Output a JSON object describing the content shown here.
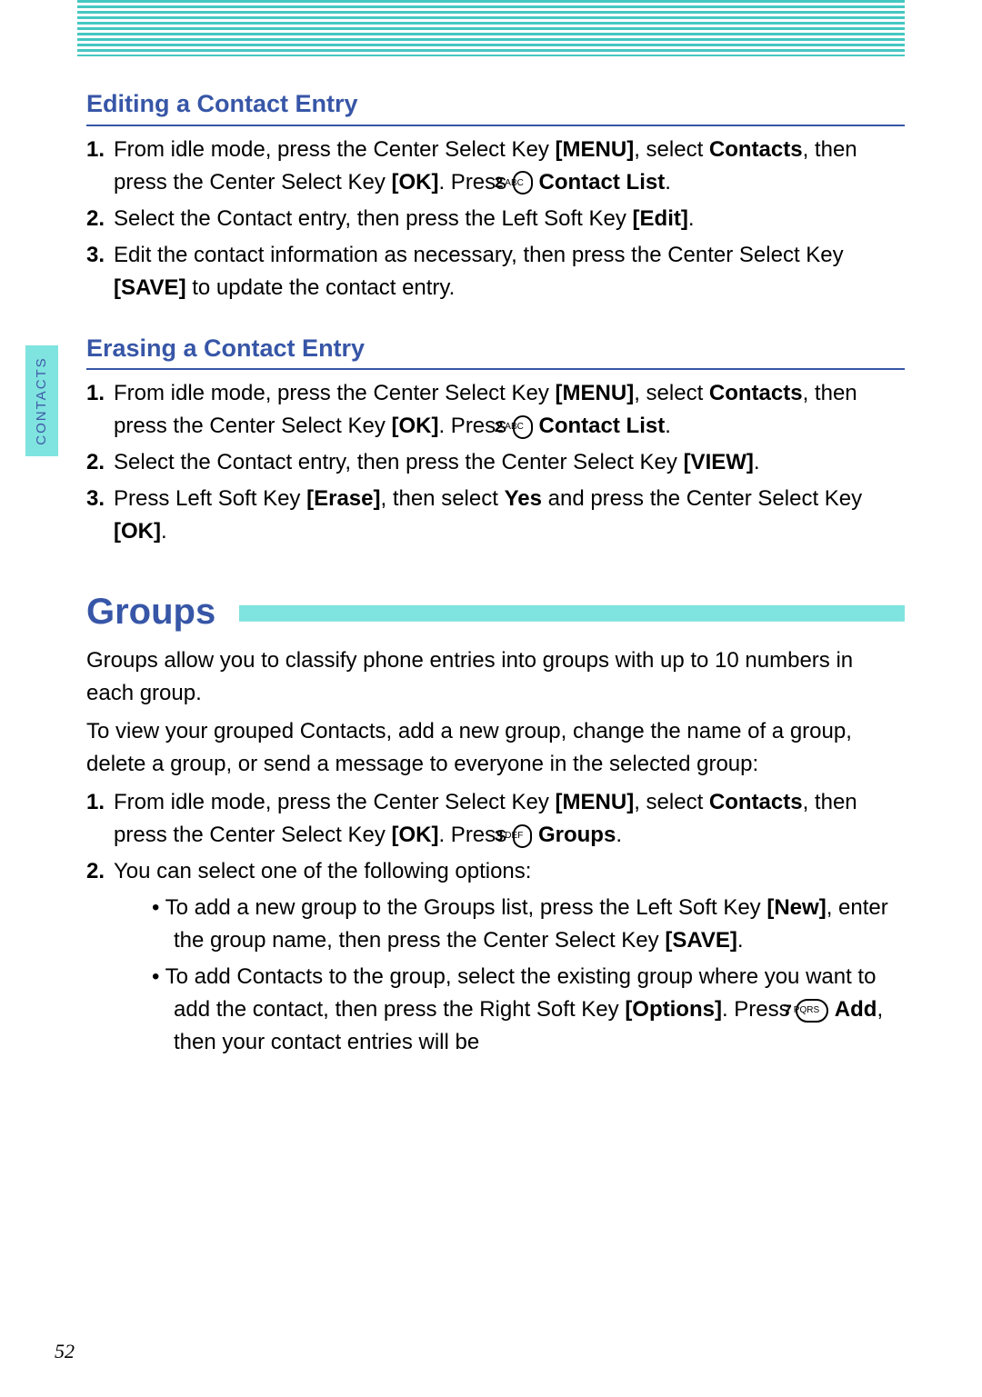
{
  "sidebarTab": "CONTACTS",
  "pageNumber": "52",
  "keys": {
    "menu": "[MENU]",
    "ok": "[OK]",
    "edit": "[Edit]",
    "save": "[SAVE]",
    "view": "[VIEW]",
    "erase": "[Erase]",
    "new": "[New]",
    "options": "[Options]"
  },
  "phoneKeys": {
    "k2": {
      "num": "2",
      "letters": "ABC"
    },
    "k3": {
      "num": "3",
      "letters": "DEF"
    },
    "k7": {
      "num": "7",
      "letters": "PQRS"
    }
  },
  "editing": {
    "heading": "Editing a Contact Entry",
    "s1a": "From idle mode, press the Center Select Key ",
    "s1b": ", select ",
    "s1c": "Contacts",
    "s1d": ", then press the Center Select Key ",
    "s1e": ". Press ",
    "s1f": "Contact List",
    "s1g": ".",
    "s2a": "Select the Contact entry, then press the Left Soft Key ",
    "s2b": ".",
    "s3a": "Edit the contact information as necessary, then press the Center Select Key ",
    "s3b": " to update the contact entry."
  },
  "erasing": {
    "heading": "Erasing a Contact Entry",
    "s1a": "From idle mode, press the Center Select Key ",
    "s1b": ", select ",
    "s1c": "Contacts",
    "s1d": ", then press the Center Select Key ",
    "s1e": ". Press ",
    "s1f": "Contact List",
    "s1g": ".",
    "s2a": "Select the Contact entry, then press the Center Select Key ",
    "s2b": ".",
    "s3a": "Press Left Soft Key ",
    "s3b": ", then select ",
    "s3c": "Yes",
    "s3d": " and press the Center Select Key ",
    "s3e": "."
  },
  "groups": {
    "title": "Groups",
    "intro1": "Groups allow you to classify phone entries into groups with up to 10 numbers in each group.",
    "intro2": "To view your grouped Contacts, add a new group, change the name of a group, delete a group, or send a message to everyone in the selected group:",
    "s1a": "From idle mode, press the Center Select Key ",
    "s1b": ", select ",
    "s1c": "Contacts",
    "s1d": ", then press the Center Select Key ",
    "s1e": ". Press ",
    "s1f": "Groups",
    "s1g": ".",
    "s2": "You can select one of the following options:",
    "b1a": "To add a new group to the Groups list, press the Left Soft Key ",
    "b1b": ", enter the group name, then press the Center Select Key ",
    "b1c": ".",
    "b2a": "To add Contacts to the group, select the existing group where you want to add the contact, then press the Right Soft Key ",
    "b2b": ". Press ",
    "b2c": "Add",
    "b2d": ", then your contact entries will be"
  }
}
